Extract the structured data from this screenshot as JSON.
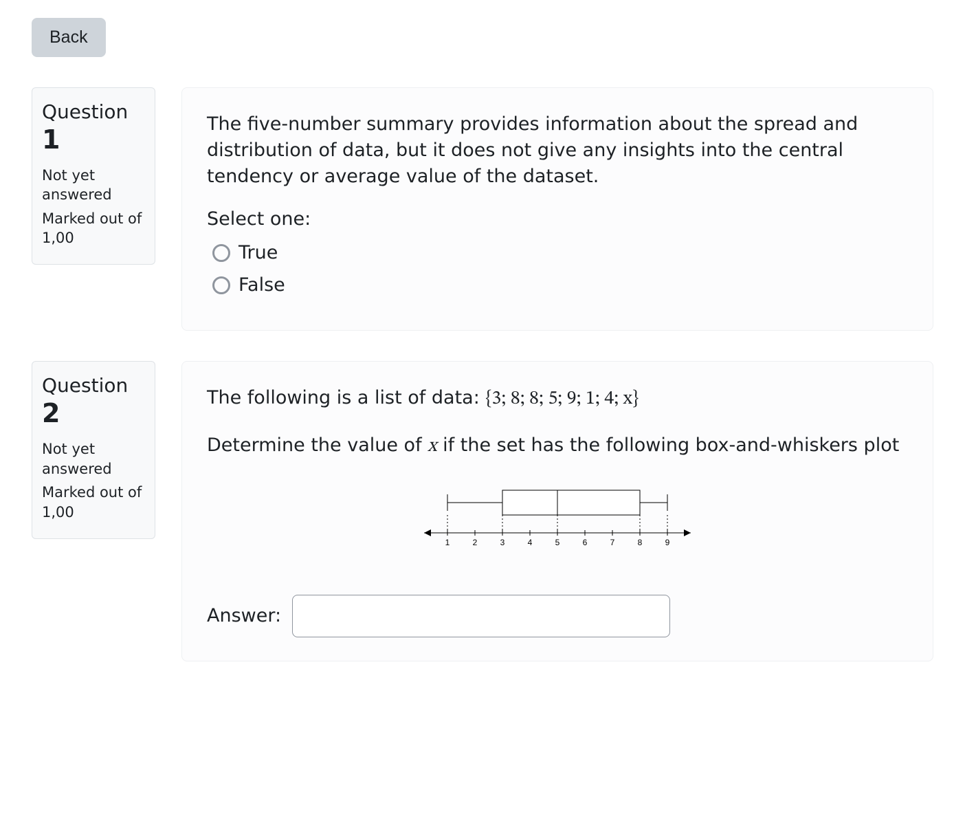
{
  "nav": {
    "back_label": "Back"
  },
  "q1": {
    "panel": {
      "label": "Question",
      "number": "1",
      "status": "Not yet answered",
      "mark_prefix": "Marked out of",
      "mark_value": "1,00"
    },
    "text": "The five-number summary provides information about the spread and distribution of data, but it does not give any insights into the central tendency or average value of the dataset.",
    "select_one": "Select one:",
    "options": {
      "true": "True",
      "false": "False"
    }
  },
  "q2": {
    "panel": {
      "label": "Question",
      "number": "2",
      "status": "Not yet answered",
      "mark_prefix": "Marked out of",
      "mark_value": "1,00"
    },
    "intro": "The following is a list of data: ",
    "dataset": "{3; 8; 8; 5; 9; 1; 4; x}",
    "line2a": "Determine the value of ",
    "var": "x",
    "line2b": " if the set has the following box-and-whiskers plot",
    "answer_label": "Answer:",
    "answer_value": ""
  },
  "chart_data": {
    "type": "boxplot",
    "axis": {
      "min": 0.5,
      "max": 9.5,
      "ticks": [
        1,
        2,
        3,
        4,
        5,
        6,
        7,
        8,
        9
      ]
    },
    "min": 1,
    "q1": 3,
    "median": 5,
    "q3": 8,
    "max": 9
  }
}
